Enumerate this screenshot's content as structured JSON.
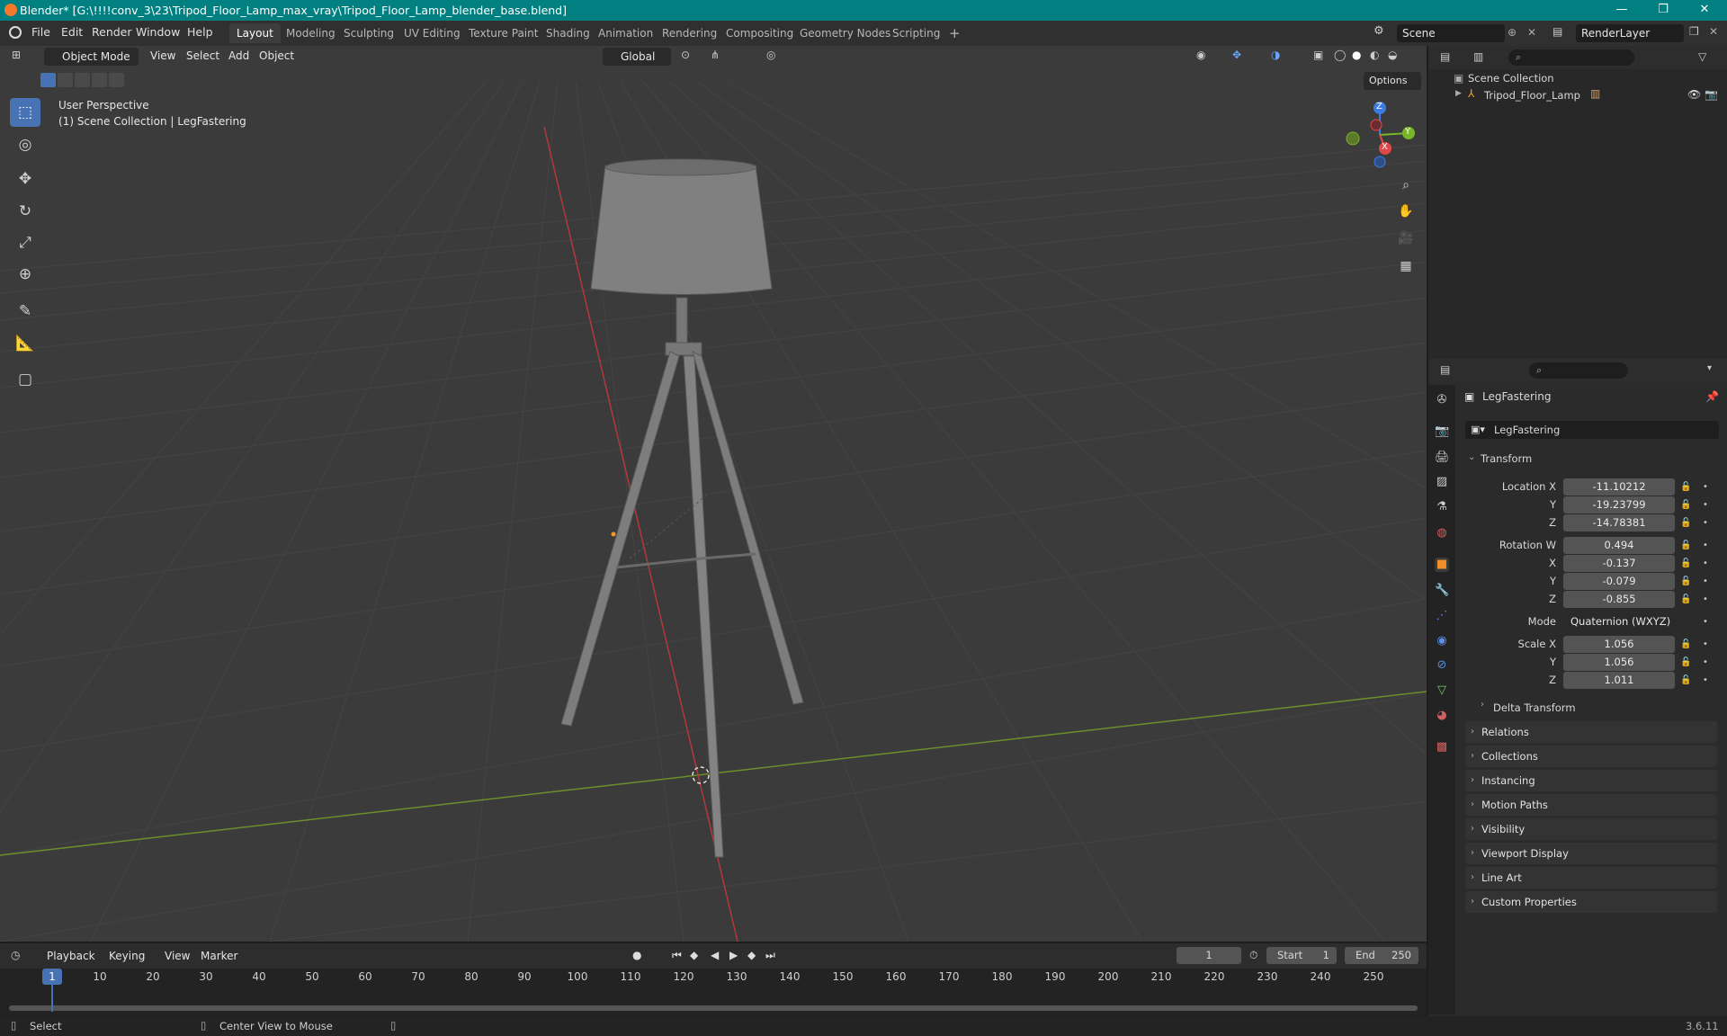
{
  "window": {
    "title": "Blender* [G:\\!!!!conv_3\\23\\Tripod_Floor_Lamp_max_vray\\Tripod_Floor_Lamp_blender_base.blend]",
    "minimize": "—",
    "maximize": "❐",
    "close": "✕"
  },
  "menu": [
    "File",
    "Edit",
    "Render",
    "Window",
    "Help"
  ],
  "workspaces": [
    "Layout",
    "Modeling",
    "Sculpting",
    "UV Editing",
    "Texture Paint",
    "Shading",
    "Animation",
    "Rendering",
    "Compositing",
    "Geometry Nodes",
    "Scripting"
  ],
  "workspace_add": "+",
  "scene": {
    "label": "Scene",
    "renderlayer": "RenderLayer"
  },
  "viewport_header": {
    "mode": "Object Mode",
    "menus": [
      "View",
      "Select",
      "Add",
      "Object"
    ],
    "orientation": "Global",
    "options": "Options"
  },
  "viewport_overlay": {
    "line1": "User Perspective",
    "line2": "(1) Scene Collection | LegFastering"
  },
  "gizmo": {
    "x": "X",
    "y": "Y",
    "z": "Z"
  },
  "outliner": {
    "root": "Scene Collection",
    "items": [
      {
        "name": "Tripod_Floor_Lamp"
      }
    ]
  },
  "properties": {
    "object_name": "LegFastering",
    "datablock": "LegFastering",
    "transform_title": "Transform",
    "location": {
      "label": "Location X",
      "x": "-11.10212",
      "y": "-19.23799",
      "z": "-14.78381"
    },
    "rotation": {
      "label": "Rotation W",
      "w": "0.494",
      "x": "-0.137",
      "y": "-0.079",
      "z": "-0.855"
    },
    "mode": {
      "label": "Mode",
      "value": "Quaternion (WXYZ)"
    },
    "scale": {
      "label": "Scale X",
      "x": "1.056",
      "y": "1.056",
      "z": "1.011"
    },
    "axis_labels": {
      "y": "Y",
      "z": "Z",
      "x": "X"
    },
    "delta": "Delta Transform",
    "panels": [
      "Relations",
      "Collections",
      "Instancing",
      "Motion Paths",
      "Visibility",
      "Viewport Display",
      "Line Art",
      "Custom Properties"
    ]
  },
  "timeline": {
    "menus": [
      "Playback",
      "Keying",
      "View",
      "Marker"
    ],
    "current_frame": "1",
    "start_label": "Start",
    "start": "1",
    "end_label": "End",
    "end": "250",
    "ticks": [
      "1",
      "10",
      "20",
      "30",
      "40",
      "50",
      "60",
      "70",
      "80",
      "90",
      "100",
      "110",
      "120",
      "130",
      "140",
      "150",
      "160",
      "170",
      "180",
      "190",
      "200",
      "210",
      "220",
      "230",
      "240",
      "250"
    ]
  },
  "status": {
    "select": "Select",
    "center": "Center View to Mouse",
    "version": "3.6.11"
  }
}
